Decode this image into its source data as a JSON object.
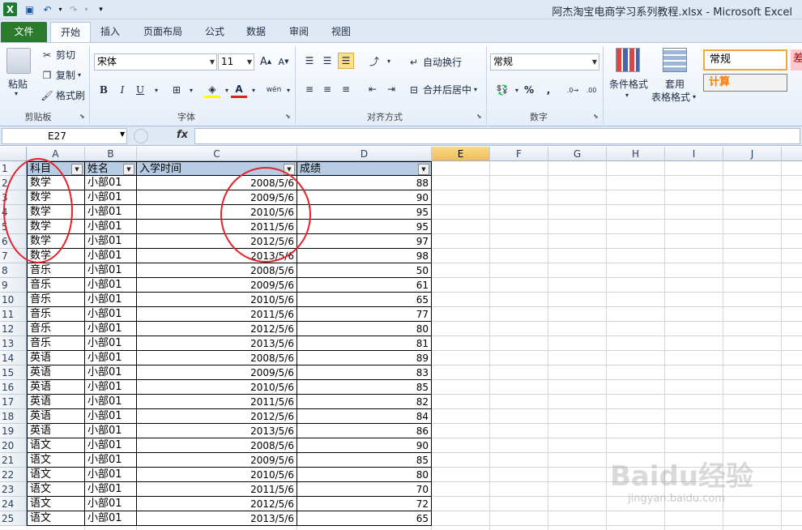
{
  "titlebar": {
    "title": "阿杰淘宝电商学习系列教程.xlsx  -  Microsoft Excel"
  },
  "tabs": [
    "文件",
    "开始",
    "插入",
    "页面布局",
    "公式",
    "数据",
    "审阅",
    "视图"
  ],
  "clipboard": {
    "paste": "粘贴",
    "cut": "剪切",
    "copy": "复制",
    "format_painter": "格式刷",
    "label": "剪贴板"
  },
  "font": {
    "name": "宋体",
    "size": "11",
    "label": "字体",
    "bold": "B",
    "italic": "I",
    "underline": "U"
  },
  "alignment": {
    "wrap": "自动换行",
    "merge": "合并后居中",
    "label": "对齐方式"
  },
  "number": {
    "format": "常规",
    "percent": "%",
    "comma": ",",
    "label": "数字"
  },
  "styles": {
    "conditional": "条件格式",
    "table_line1": "套用",
    "table_line2": "表格格式",
    "normal": "常规",
    "calc": "计算",
    "bad": "差"
  },
  "formula_bar": {
    "name_box": "E27",
    "fx": "fx",
    "value": ""
  },
  "columns": [
    "A",
    "B",
    "C",
    "D",
    "E",
    "F",
    "G",
    "H",
    "I",
    "J"
  ],
  "header_row": [
    "科目",
    "姓名",
    "入学时间",
    "成绩"
  ],
  "rows": [
    [
      "数学",
      "小部01",
      "2008/5/6",
      "88"
    ],
    [
      "数学",
      "小部01",
      "2009/5/6",
      "90"
    ],
    [
      "数学",
      "小部01",
      "2010/5/6",
      "95"
    ],
    [
      "数学",
      "小部01",
      "2011/5/6",
      "95"
    ],
    [
      "数学",
      "小部01",
      "2012/5/6",
      "97"
    ],
    [
      "数学",
      "小部01",
      "2013/5/6",
      "98"
    ],
    [
      "音乐",
      "小部01",
      "2008/5/6",
      "50"
    ],
    [
      "音乐",
      "小部01",
      "2009/5/6",
      "61"
    ],
    [
      "音乐",
      "小部01",
      "2010/5/6",
      "65"
    ],
    [
      "音乐",
      "小部01",
      "2011/5/6",
      "77"
    ],
    [
      "音乐",
      "小部01",
      "2012/5/6",
      "80"
    ],
    [
      "音乐",
      "小部01",
      "2013/5/6",
      "81"
    ],
    [
      "英语",
      "小部01",
      "2008/5/6",
      "89"
    ],
    [
      "英语",
      "小部01",
      "2009/5/6",
      "83"
    ],
    [
      "英语",
      "小部01",
      "2010/5/6",
      "85"
    ],
    [
      "英语",
      "小部01",
      "2011/5/6",
      "82"
    ],
    [
      "英语",
      "小部01",
      "2012/5/6",
      "84"
    ],
    [
      "英语",
      "小部01",
      "2013/5/6",
      "86"
    ],
    [
      "语文",
      "小部01",
      "2008/5/6",
      "90"
    ],
    [
      "语文",
      "小部01",
      "2009/5/6",
      "85"
    ],
    [
      "语文",
      "小部01",
      "2010/5/6",
      "80"
    ],
    [
      "语文",
      "小部01",
      "2011/5/6",
      "70"
    ],
    [
      "语文",
      "小部01",
      "2012/5/6",
      "72"
    ],
    [
      "语文",
      "小部01",
      "2013/5/6",
      "65"
    ]
  ],
  "watermark": {
    "brand": "Baidu经验",
    "url": "jingyan.baidu.com"
  },
  "colors": {
    "file_tab": "#2c7b2c",
    "header_fill": "#b8cce4",
    "annotation_circle": "#e0242a",
    "selected_col": "#f0bf54"
  }
}
